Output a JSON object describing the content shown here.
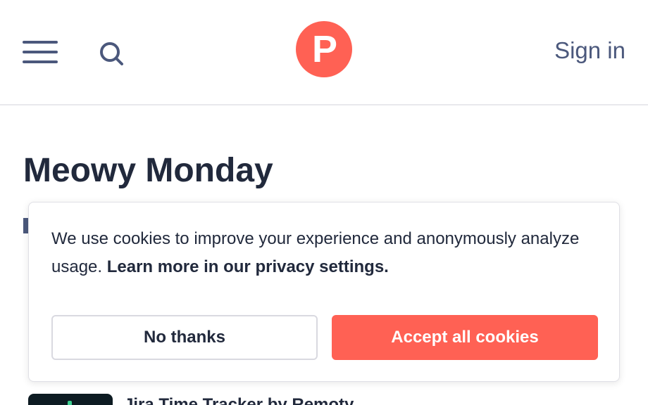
{
  "header": {
    "logo_letter": "P",
    "sign_in_label": "Sign in",
    "menu_icon": "hamburger-menu-icon",
    "search_icon": "search-icon"
  },
  "main": {
    "page_title": "Meowy Monday",
    "product_title": "Jira Time Tracker by Remoty"
  },
  "cookie_banner": {
    "text": "We use cookies to improve your experience and anonymously analyze usage.",
    "link_text": "Learn more in our privacy settings.",
    "decline_label": "No thanks",
    "accept_label": "Accept all cookies"
  },
  "colors": {
    "brand": "#ff6154",
    "text_dark": "#21293c",
    "text_muted": "#4b587c"
  }
}
